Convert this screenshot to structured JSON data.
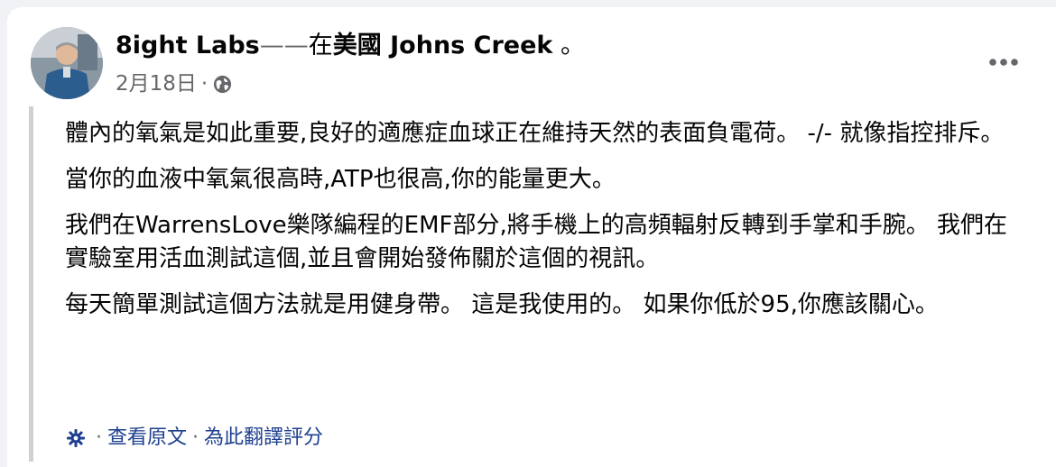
{
  "post": {
    "author": "8ight Labs",
    "dash": "——",
    "location_prefix": "在",
    "location": "美國 Johns Creek",
    "location_suffix": " 。",
    "date": "2月18日",
    "meta_separator": "·",
    "privacy_icon": "globe-icon",
    "more_icon": "more-options-icon",
    "paragraphs": [
      "體內的氧氣是如此重要,良好的適應症血球正在維持天然的表面負電荷。 -/- 就像指控排斥。",
      "當你的血液中氧氣很高時,ATP也很高,你的能量更大。",
      "我們在WarrensLove樂隊編程的EMF部分,將手機上的高頻輻射反轉到手掌和手腕。 我們在實驗室用活血測試這個,並且會開始發佈關於這個的視訊。",
      "每天簡單測試這個方法就是用健身帶。 這是我使用的。 如果你低於95,你應該關心。"
    ]
  },
  "translation": {
    "icon": "translate-gear-icon",
    "separator": "·",
    "see_original": "查看原文",
    "rate_translation": "為此翻譯評分"
  },
  "colors": {
    "background": "#f0f2f5",
    "card": "#ffffff",
    "text": "#050505",
    "secondary_text": "#65676b",
    "link": "#1d3f8f",
    "quote_bar": "#ced0d4"
  }
}
